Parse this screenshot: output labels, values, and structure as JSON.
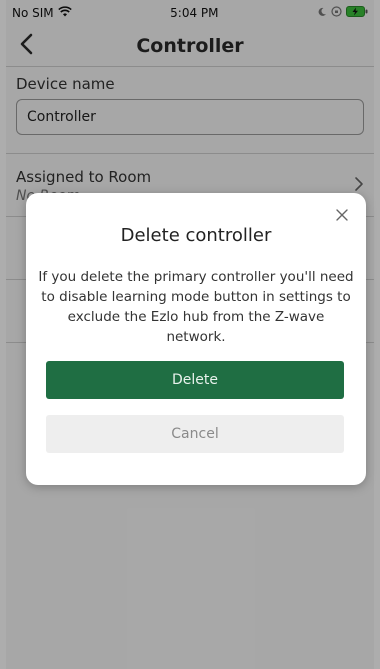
{
  "status_bar": {
    "carrier": "No SIM",
    "time": "5:04 PM"
  },
  "nav": {
    "title": "Controller"
  },
  "device_name": {
    "label": "Device name",
    "value": "Controller"
  },
  "assigned_room": {
    "label": "Assigned to Room",
    "value": "No Room"
  },
  "dialog": {
    "title": "Delete controller",
    "message": "If you delete the primary controller you'll need to disable learning mode button in settings to exclude the Ezlo hub from the Z-wave network.",
    "delete_label": "Delete",
    "cancel_label": "Cancel"
  },
  "colors": {
    "primary": "#1f6e43",
    "battery": "#3bbf3b"
  }
}
